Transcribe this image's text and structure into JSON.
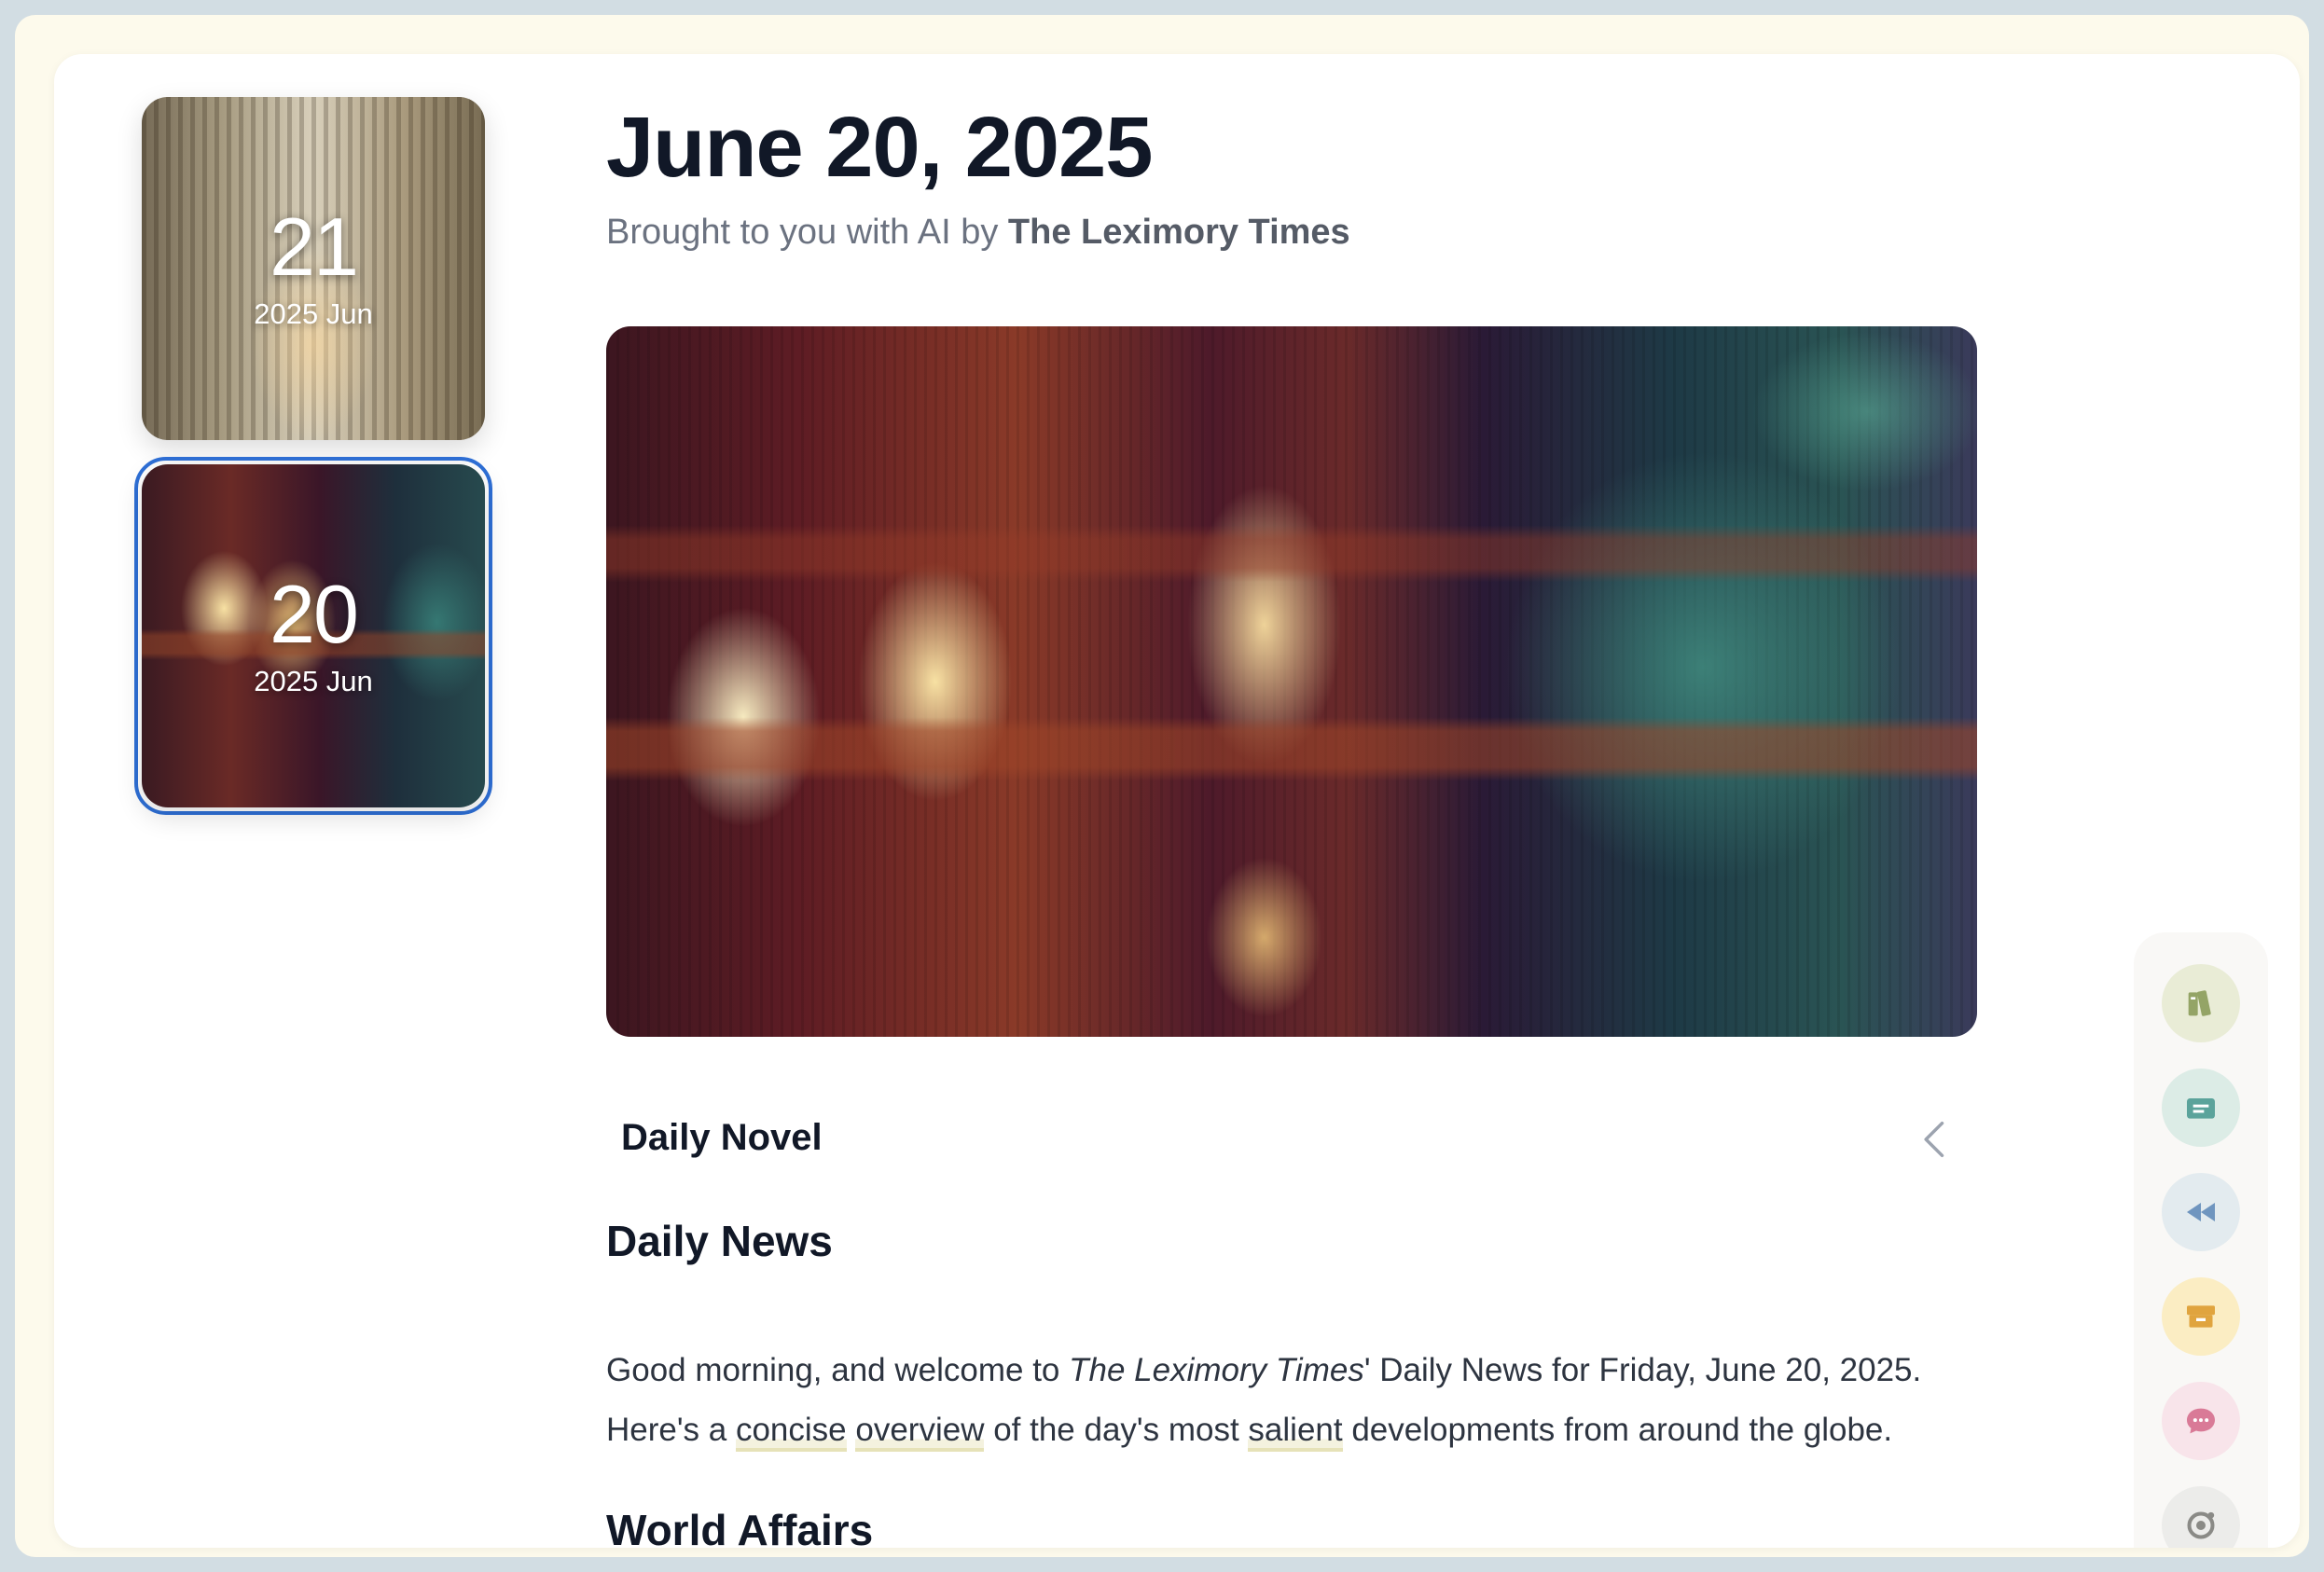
{
  "sidebar": {
    "cards": [
      {
        "day": "21",
        "ym": "2025 Jun"
      },
      {
        "day": "20",
        "ym": "2025 Jun"
      }
    ]
  },
  "header": {
    "title": "June 20, 2025",
    "subtitle_prefix": "Brought to you with AI by ",
    "subtitle_brand": "The Leximory Times"
  },
  "novel": {
    "label": "Daily Novel"
  },
  "news": {
    "heading": "Daily News",
    "p_start": "Good morning, and welcome to ",
    "p_pub": "The Leximory Times",
    "p_rest1": "' Daily News for Friday, June 20, 2025. Here's a ",
    "p_w1": "concise",
    "p_space1": " ",
    "p_w2": "overview",
    "p_rest2": " of the day's most ",
    "p_w3": "salient",
    "p_rest3": " developments from around the globe."
  },
  "world": {
    "heading": "World Affairs"
  },
  "toolbar": [
    {
      "icon": "books-icon",
      "bg": "#e9ecd6",
      "fg": "#94a466"
    },
    {
      "icon": "newspaper-icon",
      "bg": "#dcece6",
      "fg": "#5ba39b"
    },
    {
      "icon": "rewind-icon",
      "bg": "#e3ebef",
      "fg": "#6f95bf"
    },
    {
      "icon": "store-icon",
      "bg": "#fbedc3",
      "fg": "#e0a43e"
    },
    {
      "icon": "chat-icon",
      "bg": "#f8e4ea",
      "fg": "#d97a97"
    },
    {
      "icon": "settings-icon",
      "bg": "#ececea",
      "fg": "#8a8a86"
    }
  ]
}
